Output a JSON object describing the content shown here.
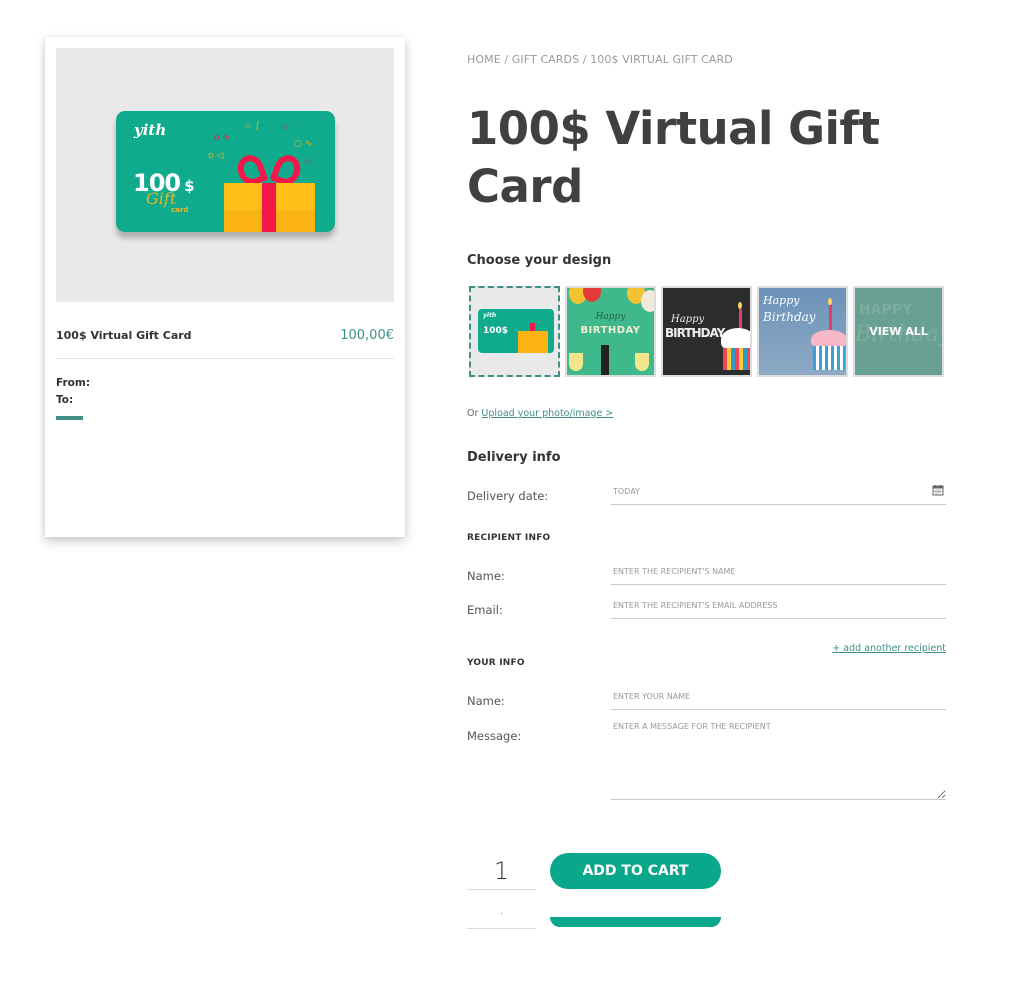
{
  "breadcrumb": {
    "items": [
      "HOME",
      "GIFT CARDS",
      "100$ VIRTUAL GIFT CARD"
    ],
    "separator": " / "
  },
  "product": {
    "title": "100$ Virtual Gift Card",
    "price": "100,00€"
  },
  "preview": {
    "card_logo": "yith",
    "card_amount": "100",
    "card_currency": "$",
    "card_script": "Gift",
    "card_small": "card",
    "title": "100$ Virtual Gift Card",
    "price": "100,00€",
    "from_label": "From:",
    "to_label": "To:"
  },
  "design": {
    "heading": "Choose your design",
    "thumbnails": [
      {
        "name": "default-gift-card",
        "label": "100$",
        "selected": true
      },
      {
        "name": "happy-birthday-green",
        "label": "BIRTHDAY",
        "sublabel": "Happy",
        "selected": false
      },
      {
        "name": "happy-birthday-chalk",
        "label": "BIRTHDAY",
        "sublabel": "Happy",
        "selected": false
      },
      {
        "name": "happy-birthday-blue",
        "label": "Birthday",
        "sublabel": "Happy",
        "selected": false
      },
      {
        "name": "view-all",
        "label": "VIEW ALL",
        "selected": false
      }
    ],
    "upload_prefix": "Or ",
    "upload_link": "Upload your photo/image >"
  },
  "delivery": {
    "heading": "Delivery info",
    "date_label": "Delivery date:",
    "date_placeholder": "TODAY"
  },
  "recipient": {
    "heading": "RECIPIENT INFO",
    "name_label": "Name:",
    "name_placeholder": "ENTER THE RECIPIENT'S NAME",
    "email_label": "Email:",
    "email_placeholder": "ENTER THE RECIPIENT'S EMAIL ADDRESS",
    "add_another": "+ add another recipient"
  },
  "sender": {
    "heading": "YOUR INFO",
    "name_label": "Name:",
    "name_placeholder": "ENTER YOUR NAME",
    "message_label": "Message:",
    "message_placeholder": "ENTER A MESSAGE FOR THE RECIPIENT"
  },
  "cart": {
    "quantity": "1",
    "quantity_secondary": ".",
    "add_to_cart_label": "ADD TO CART"
  },
  "colors": {
    "accent": "#0aa88b",
    "link": "#3f8f86",
    "title": "#404040"
  }
}
